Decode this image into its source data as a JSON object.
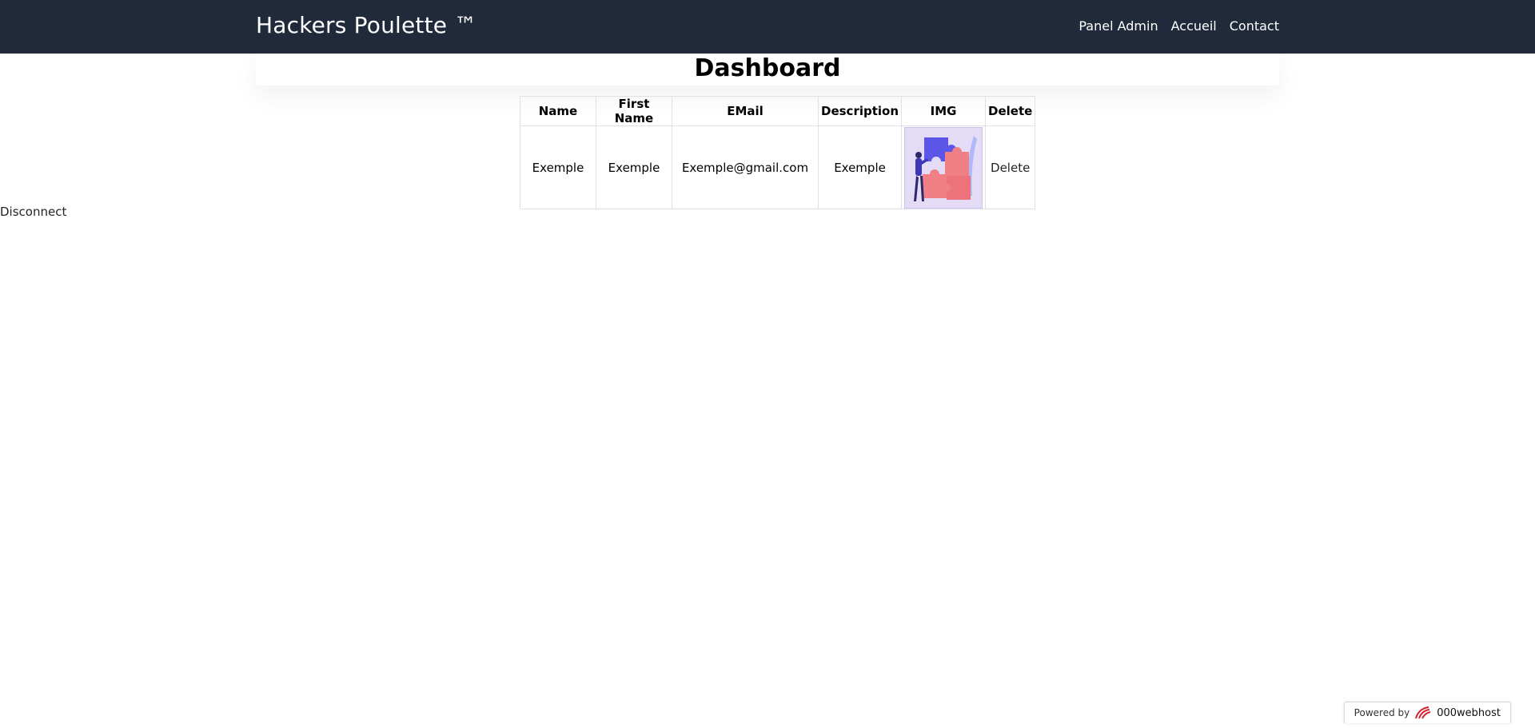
{
  "navbar": {
    "brand": "Hackers Poulette ™",
    "links": [
      "Panel Admin",
      "Accueil",
      "Contact"
    ]
  },
  "page_title": "Dashboard",
  "table": {
    "headers": [
      "Name",
      "First Name",
      "EMail",
      "Description",
      "IMG",
      "Delete"
    ],
    "rows": [
      {
        "name": "Exemple",
        "first_name": "Exemple",
        "email": "Exemple@gmail.com",
        "description": "Exemple",
        "img_icon": "puzzle-illustration",
        "delete": "Delete"
      }
    ]
  },
  "disconnect_label": "Disconnect",
  "footer_badge": {
    "prefix": "Powered by",
    "host": "000webhost",
    "logo_icon": "000webhost-logo-icon"
  },
  "colors": {
    "navbar_bg": "#212a3a",
    "nav_text": "#ffffff"
  }
}
